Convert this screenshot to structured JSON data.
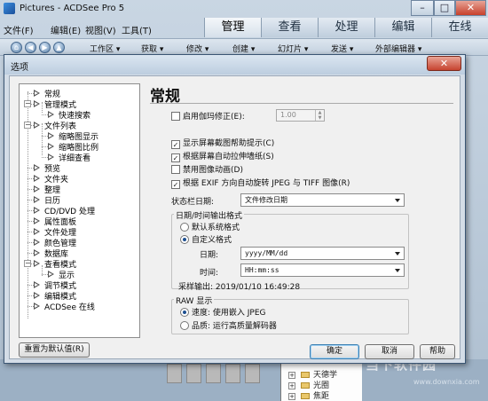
{
  "app": {
    "title": "Pictures - ACDSee Pro 5",
    "window_buttons": [
      "–",
      "□",
      "✕"
    ],
    "menu": [
      "文件(F)",
      "编辑(E)",
      "视图(V)",
      "工具(T)"
    ],
    "mode_tabs": [
      "管理",
      "查看",
      "处理",
      "编辑",
      "在线"
    ],
    "toolbar": [
      "工作区 ▾",
      "获取 ▾",
      "修改 ▾",
      "创建 ▾",
      "幻灯片 ▾",
      "发送 ▾",
      "外部编辑器 ▾"
    ],
    "tree_items": [
      "天德学",
      "光圈",
      "焦距"
    ],
    "watermark": "当下软件园",
    "watermark_url": "www.downxia.com"
  },
  "dialog": {
    "title": "选项",
    "close_glyph": "✕",
    "categories": [
      "常规",
      "管理模式",
      "快速搜索",
      "文件列表",
      "缩略图显示",
      "缩略图比例",
      "详细查看",
      "预览",
      "文件夹",
      "整理",
      "日历",
      "CD/DVD 处理",
      "属性面板",
      "文件处理",
      "颜色管理",
      "数据库",
      "查看模式",
      "显示",
      "调节模式",
      "编辑模式",
      "ACDSee 在线"
    ],
    "panel_title": "常规",
    "gamma": {
      "label": "启用伽玛修正(E):",
      "value": "1.00",
      "checked": false
    },
    "checkboxes": [
      {
        "label": "显示屏幕截图帮助提示(C)",
        "checked": true
      },
      {
        "label": "根据屏幕自动拉伸墙纸(S)",
        "checked": true
      },
      {
        "label": "禁用图像动画(D)",
        "checked": false
      },
      {
        "label": "根据 EXIF 方向自动旋转 JPEG 与 TIFF 图像(R)",
        "checked": true
      }
    ],
    "status_date": {
      "label": "状态栏日期:",
      "value": "文件修改日期"
    },
    "datetime_group": {
      "label": "日期/时间输出格式",
      "options": [
        {
          "label": "默认系统格式",
          "selected": false
        },
        {
          "label": "自定义格式",
          "selected": true
        }
      ],
      "date_label": "日期:",
      "date_value": "yyyy/MM/dd",
      "time_label": "时间:",
      "time_value": "HH:mm:ss",
      "sample_label": "采样输出:",
      "sample_value": "2019/01/10 16:49:28"
    },
    "raw_group": {
      "label": "RAW 显示",
      "options": [
        {
          "label": "速度: 使用嵌入 JPEG",
          "selected": true
        },
        {
          "label": "品质: 运行高质量解码器",
          "selected": false
        }
      ]
    },
    "reset_button": "重置为默认值(R)",
    "ok_button": "确定",
    "cancel_button": "取消",
    "help_button": "帮助"
  }
}
